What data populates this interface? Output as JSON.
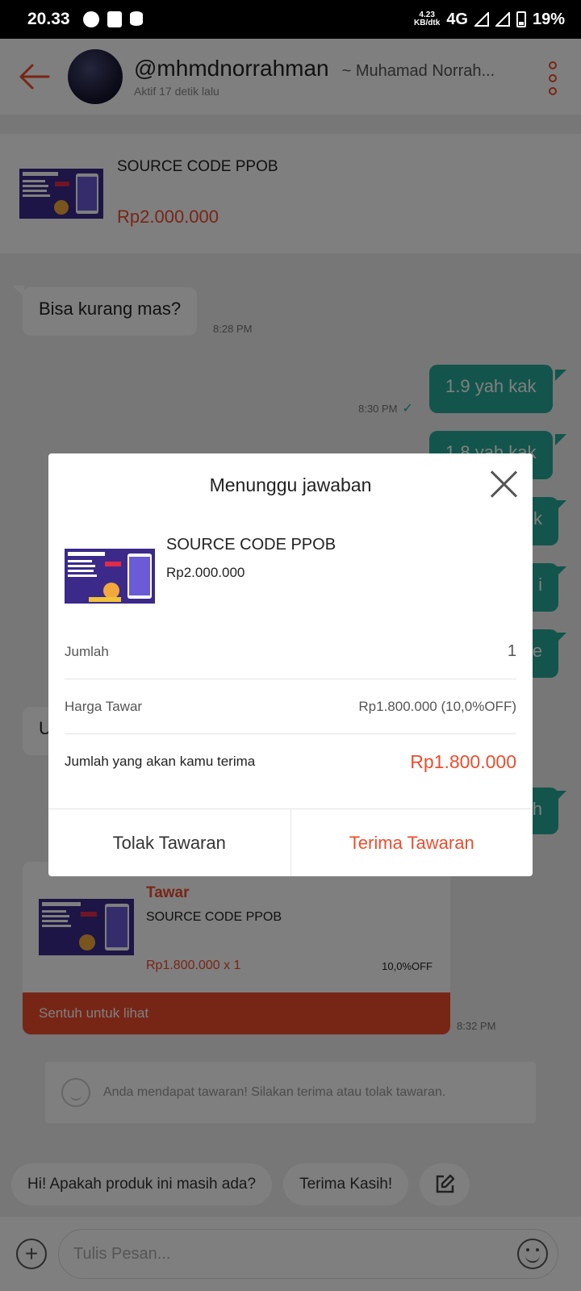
{
  "status_bar": {
    "time": "20.33",
    "net_speed_value": "4.23",
    "net_speed_unit": "KB/dtk",
    "network": "4G",
    "battery": "19%"
  },
  "header": {
    "username": "@mhmdnorrahman",
    "display_name": "~ Muhamad Norrah...",
    "status": "Aktif 17 detik lalu"
  },
  "product": {
    "title": "SOURCE CODE PPOB",
    "price": "Rp2.000.000"
  },
  "messages": [
    {
      "text": "Bisa kurang mas?",
      "time": "8:28 PM"
    },
    {
      "text": "1.9 yah kak",
      "time": "8:30 PM"
    },
    {
      "text": "1.8 yah kak",
      "time": ""
    },
    {
      "text": "k",
      "time": ""
    },
    {
      "text": "i",
      "time": ""
    },
    {
      "text": "e",
      "time": ""
    },
    {
      "text": "U",
      "time": ""
    },
    {
      "text": "h",
      "time": ""
    }
  ],
  "offer_card": {
    "tag": "Tawar",
    "title": "SOURCE CODE PPOB",
    "price_qty": "Rp1.800.000 x 1",
    "discount": "10,0%OFF",
    "action": "Sentuh untuk lihat",
    "time": "8:32 PM"
  },
  "system_message": "Anda mendapat tawaran! Silakan terima atau tolak tawaran.",
  "quick_replies": [
    "Hi! Apakah produk ini masih ada?",
    "Terima Kasih!"
  ],
  "input": {
    "placeholder": "Tulis Pesan..."
  },
  "dialog": {
    "title": "Menunggu jawaban",
    "product_title": "SOURCE CODE PPOB",
    "product_price": "Rp2.000.000",
    "rows": [
      {
        "label": "Jumlah",
        "value": "1"
      },
      {
        "label": "Harga Tawar",
        "value": "Rp1.800.000 (10,0%OFF)"
      },
      {
        "label": "Jumlah yang akan kamu terima",
        "value": "Rp1.800.000"
      }
    ],
    "reject_label": "Tolak Tawaran",
    "accept_label": "Terima Tawaran"
  },
  "colors": {
    "brand": "#ee4d2d",
    "outgoing": "#26aa99"
  },
  "icons": [
    "back-arrow-icon",
    "more-vertical-icon",
    "check-icon",
    "close-icon",
    "plus-icon",
    "emoji-icon",
    "edit-icon",
    "smiley-icon"
  ]
}
